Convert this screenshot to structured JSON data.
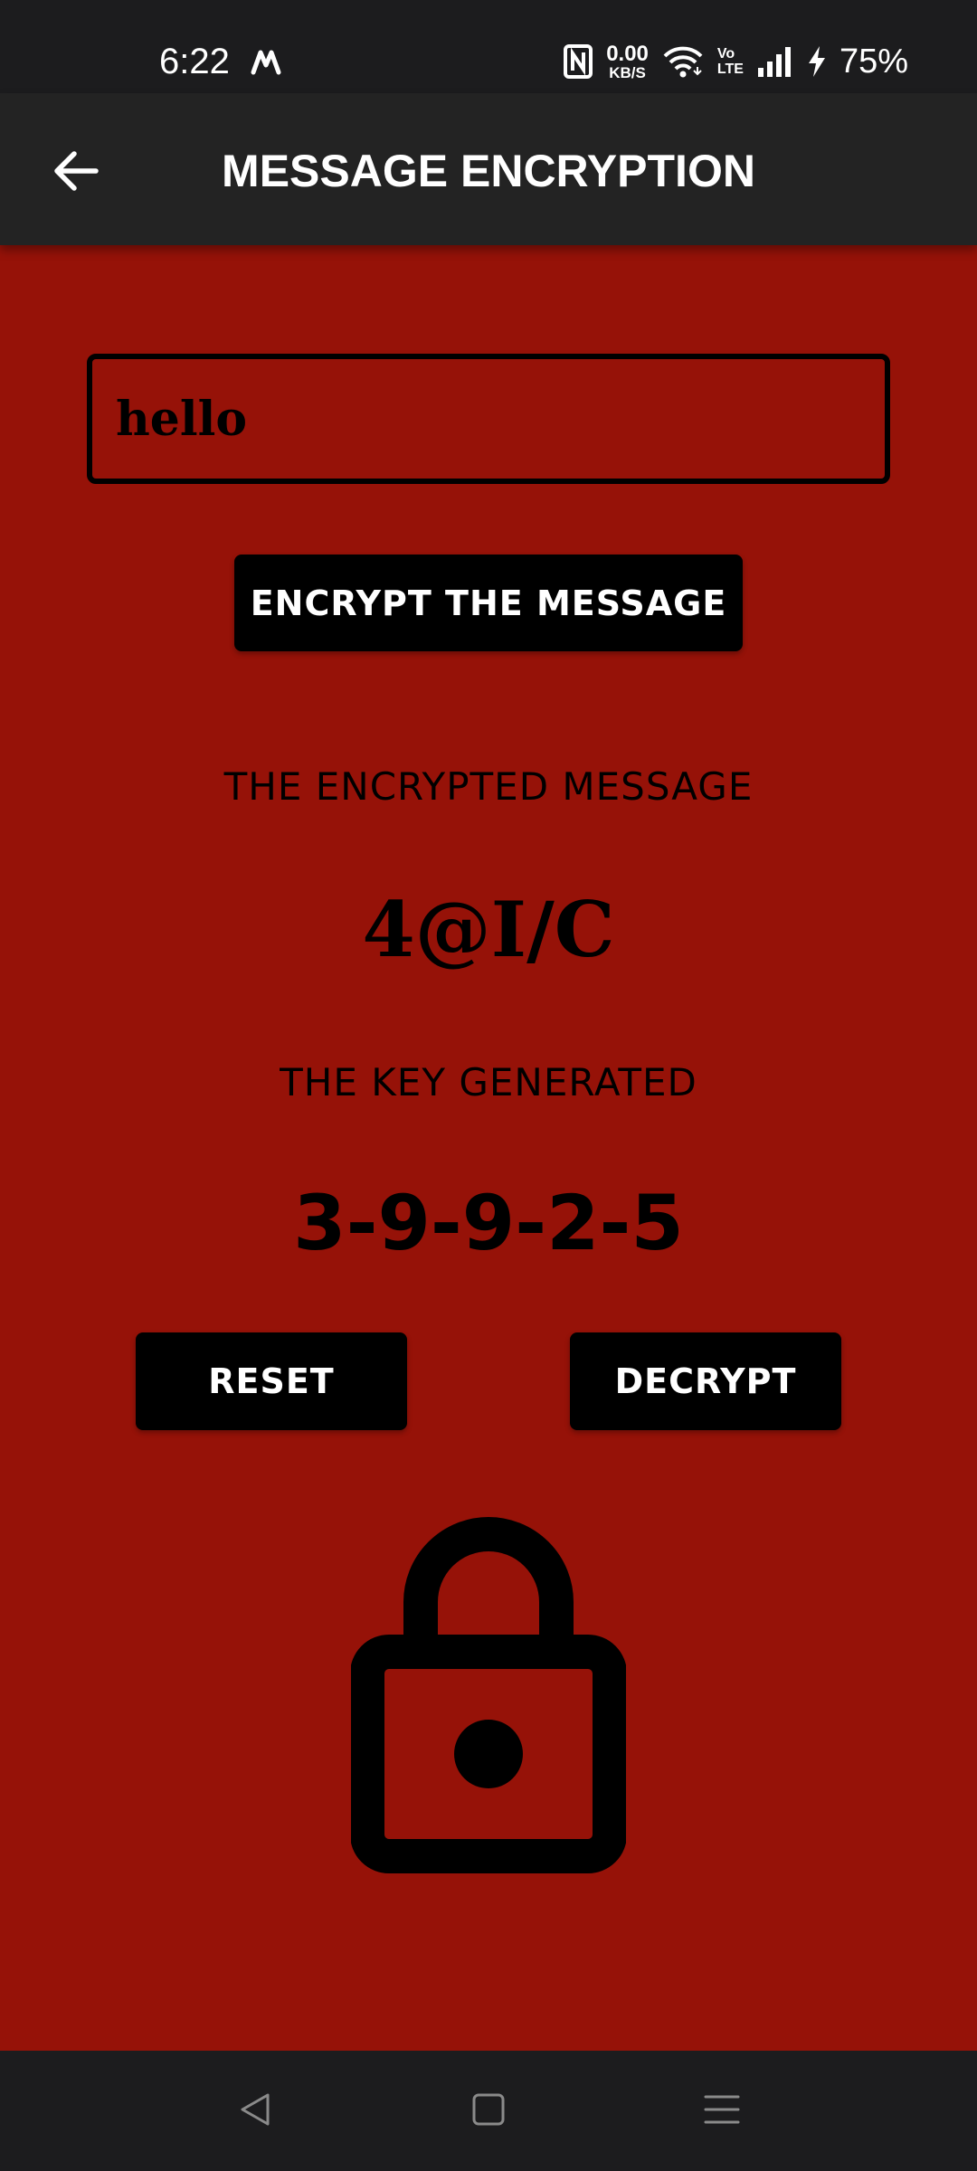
{
  "status_bar": {
    "time": "6:22",
    "network_speed_value": "0.00",
    "network_speed_unit": "KB/S",
    "volte_top": "Vo",
    "volte_bottom": "LTE",
    "battery": "75%"
  },
  "app_bar": {
    "title": "MESSAGE ENCRYPTION"
  },
  "form": {
    "message_value": "hello",
    "encrypt_label": "ENCRYPT THE MESSAGE"
  },
  "result": {
    "encrypted_label": "THE ENCRYPTED MESSAGE",
    "encrypted_value": "4@I/C",
    "key_label": "THE KEY GENERATED",
    "key_value": "3-9-9-2-5"
  },
  "actions": {
    "reset_label": "RESET",
    "decrypt_label": "DECRYPT"
  },
  "icons": {
    "back": "arrow-left-icon",
    "lock": "lock-icon",
    "nav_back": "triangle-back-icon",
    "nav_home": "square-home-icon",
    "nav_menu": "menu-lines-icon"
  },
  "colors": {
    "background": "#961208",
    "app_bar": "#232323",
    "status_bar": "#1c1c1e",
    "button": "#000000",
    "cursor": "#3b6fd6"
  }
}
